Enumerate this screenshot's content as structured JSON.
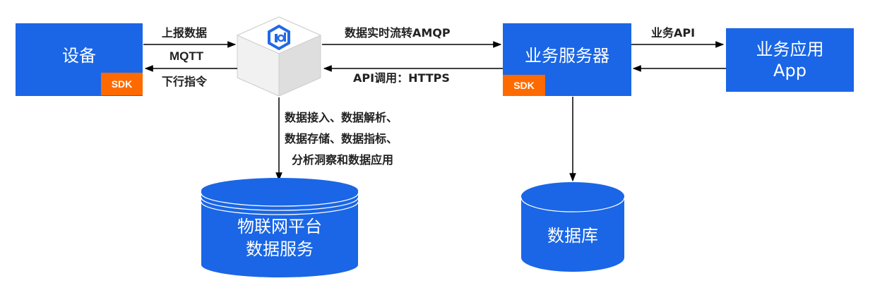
{
  "nodes": {
    "device": "设备",
    "device_sdk": "SDK",
    "business_server": "业务服务器",
    "business_server_sdk": "SDK",
    "business_app_line1": "业务应用",
    "business_app_line2": "App",
    "iot_data_service_line1": "物联网平台",
    "iot_data_service_line2": "数据服务",
    "database": "数据库"
  },
  "edges": {
    "report_data": "上报数据",
    "mqtt": "MQTT",
    "downlink_command": "下行指令",
    "realtime_flow": "数据实时流转AMQP",
    "api_call": "API调用：HTTPS",
    "business_api": "业务API",
    "data_process_line1": "数据接入、数据解析、",
    "data_process_line2": "数据存储、数据指标、",
    "data_process_line3": "分析洞察和数据应用"
  },
  "colors": {
    "box_blue": "#1a66e6",
    "sdk_orange": "#ff6a00",
    "arrow": "#000000"
  },
  "icons": {
    "platform": "iot-hexagon-icon"
  }
}
